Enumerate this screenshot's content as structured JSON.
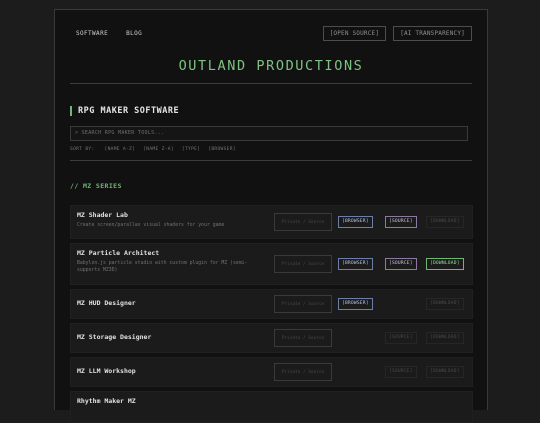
{
  "nav": {
    "links": [
      "SOFTWARE",
      "BLOG"
    ],
    "buttons": [
      "[OPEN SOURCE]",
      "[AI TRANSPARENCY]"
    ]
  },
  "brand": "OUTLAND PRODUCTIONS",
  "section": {
    "title": "RPG MAKER SOFTWARE"
  },
  "search": {
    "placeholder": "> SEARCH RPG MAKER TOOLS..."
  },
  "sort": {
    "label": "SORT BY:",
    "options": [
      "[NAME A-Z]",
      "[NAME Z-A]",
      "[TYPE]",
      "[BROWSER]"
    ]
  },
  "series": "// MZ SERIES",
  "actions": {
    "browser": "[BROWSER]",
    "source": "[SOURCE]",
    "download": "[DOWNLOAD]"
  },
  "products": [
    {
      "name": "MZ Shader Lab",
      "desc": "Create screen/parallax visual shaders for your game",
      "status": "Private / Source"
    },
    {
      "name": "MZ Particle Architect",
      "desc": "Babylon.js particle studio with custom plugin for MZ (semi-supports MZ3D)",
      "status": "Private / Source"
    },
    {
      "name": "MZ HUD Designer",
      "desc": "",
      "status": "Private / Source"
    },
    {
      "name": "MZ Storage Designer",
      "desc": "",
      "status": "Private / Source"
    },
    {
      "name": "MZ LLM Workshop",
      "desc": "",
      "status": "Private / Source"
    },
    {
      "name": "Rhythm Maker MZ",
      "desc": "",
      "status": ""
    }
  ]
}
